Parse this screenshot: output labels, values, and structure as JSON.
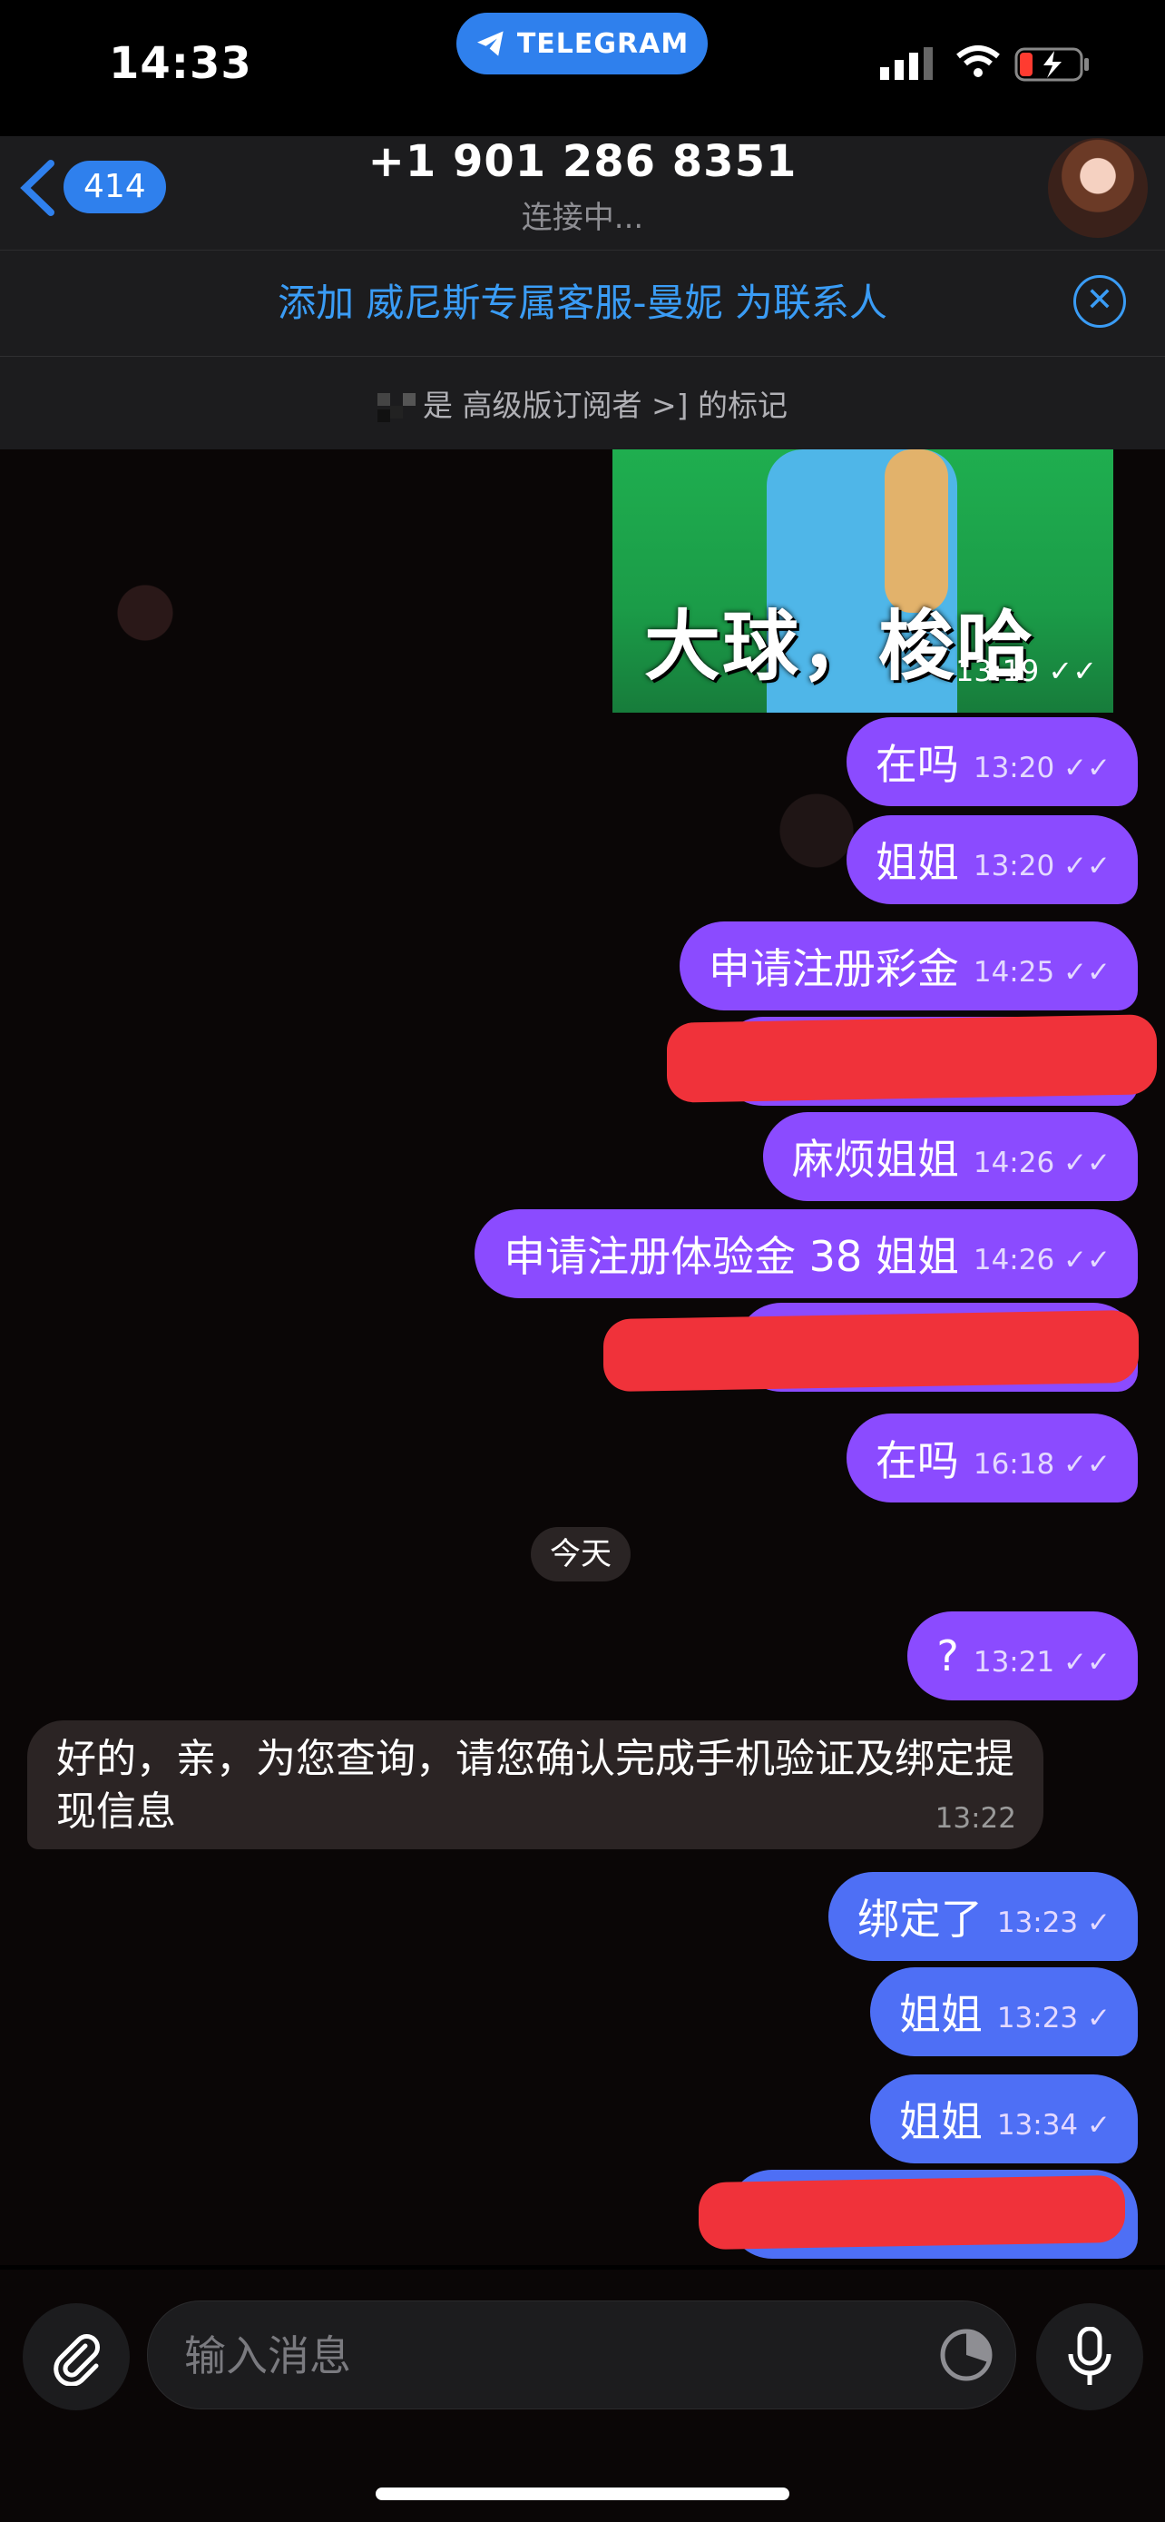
{
  "status_bar": {
    "time": "14:33",
    "app_pill": "TELEGRAM"
  },
  "header": {
    "back_count": "414",
    "title": "+1 901 286 8351",
    "subtitle": "连接中..."
  },
  "banner": {
    "add_contact": "添加 威尼斯专属客服-曼妮 为联系人",
    "premium_note": "是 高级版订阅者 >] 的标记"
  },
  "video_message": {
    "caption": "大球，梭哈",
    "time": "13:19"
  },
  "messages": [
    {
      "text": "在吗",
      "time": "13:20"
    },
    {
      "text": "姐姐",
      "time": "13:20"
    },
    {
      "text": "申请注册彩金",
      "time": "14:25"
    },
    {
      "text": "麻烦姐姐",
      "time": "14:26"
    },
    {
      "text": "申请注册体验金 38 姐姐",
      "time": "14:26"
    },
    {
      "text": "在吗",
      "time": "16:18"
    },
    {
      "text": "?",
      "time": "13:21"
    },
    {
      "text": "绑定了",
      "time": "13:23"
    },
    {
      "text": "姐姐",
      "time": "13:23"
    },
    {
      "text": "姐姐",
      "time": "13:34"
    }
  ],
  "date_separator": "今天",
  "incoming": {
    "text": "好的，亲，为您查询，请您确认完成手机验证及绑定提现信息",
    "time": "13:22"
  },
  "composer": {
    "placeholder": "输入消息"
  },
  "colors": {
    "accent": "#2f80ed",
    "outgoing_purple": "#8b4bff",
    "outgoing_blue": "#4e6ff5",
    "redaction": "#f0323a"
  }
}
